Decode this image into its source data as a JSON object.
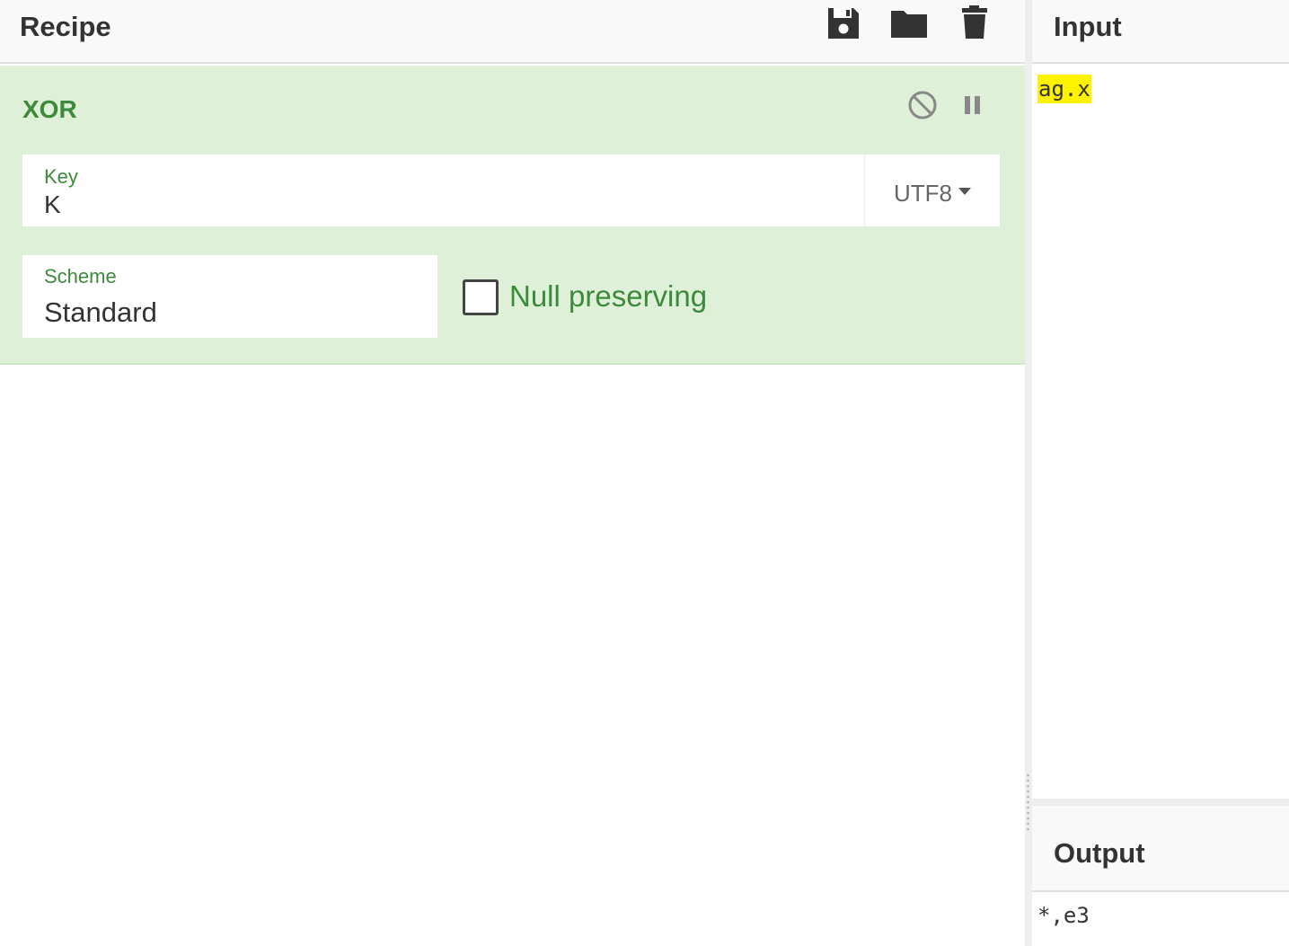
{
  "recipe": {
    "title": "Recipe",
    "toolbar": {
      "save_icon": "save-icon",
      "load_icon": "folder-icon",
      "clear_icon": "trash-icon"
    },
    "operation": {
      "name": "XOR",
      "key": {
        "label": "Key",
        "value": "K",
        "encoding": "UTF8"
      },
      "scheme": {
        "label": "Scheme",
        "value": "Standard"
      },
      "null_preserving": {
        "label": "Null preserving",
        "checked": false
      },
      "controls": [
        "disable-icon",
        "breakpoint-icon"
      ]
    }
  },
  "input": {
    "title": "Input",
    "text": "ag.x",
    "highlight_color": "#fff200"
  },
  "output": {
    "title": "Output",
    "text": "*,e3"
  },
  "colors": {
    "accent_green": "#3c8a3a",
    "op_background": "#dff0d8",
    "header_background": "#f9f9f9"
  }
}
